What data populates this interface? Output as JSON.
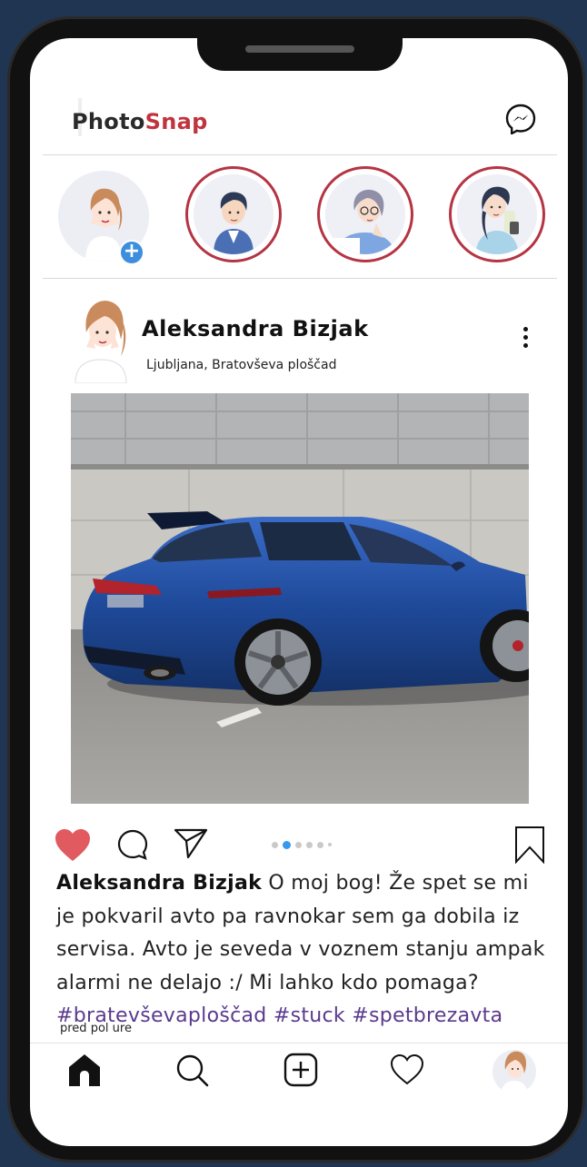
{
  "app": {
    "title_part1": "Photo",
    "title_part2": "Snap"
  },
  "stories": [
    {
      "name": "your-story",
      "own": true
    },
    {
      "name": "story-man"
    },
    {
      "name": "story-girl-glasses"
    },
    {
      "name": "story-girl-drink"
    }
  ],
  "post": {
    "user": "Aleksandra Bizjak",
    "location": "Ljubljana, Bratovševa ploščad",
    "caption_user": "Aleksandra Bizjak",
    "caption_text": " O moj bog! Že spet se mi je pokvaril avto pa ravnokar sem ga dobila iz servisa. Avto je seveda v voznem stanju ampak alarmi ne delajo :/ Mi lahko kdo pomaga?",
    "hashtags": [
      "#bratevševaploščad",
      "#stuck",
      "#spetbrezavta"
    ],
    "time": "pred pol ure",
    "liked": true,
    "carousel": {
      "count": 6,
      "active": 1
    }
  },
  "icons": {
    "messenger": "messenger-icon",
    "like": "heart-icon",
    "comment": "comment-icon",
    "share": "send-icon",
    "save": "bookmark-icon",
    "home": "home-icon",
    "search": "search-icon",
    "add": "add-post-icon",
    "activity": "heart-outline-icon",
    "profile": "profile-avatar-icon"
  },
  "colors": {
    "accent": "#c0343f",
    "like": "#e05a5f",
    "hashtag": "#5a3a8c",
    "background": "#1f3552",
    "dot_active": "#3897f0"
  }
}
